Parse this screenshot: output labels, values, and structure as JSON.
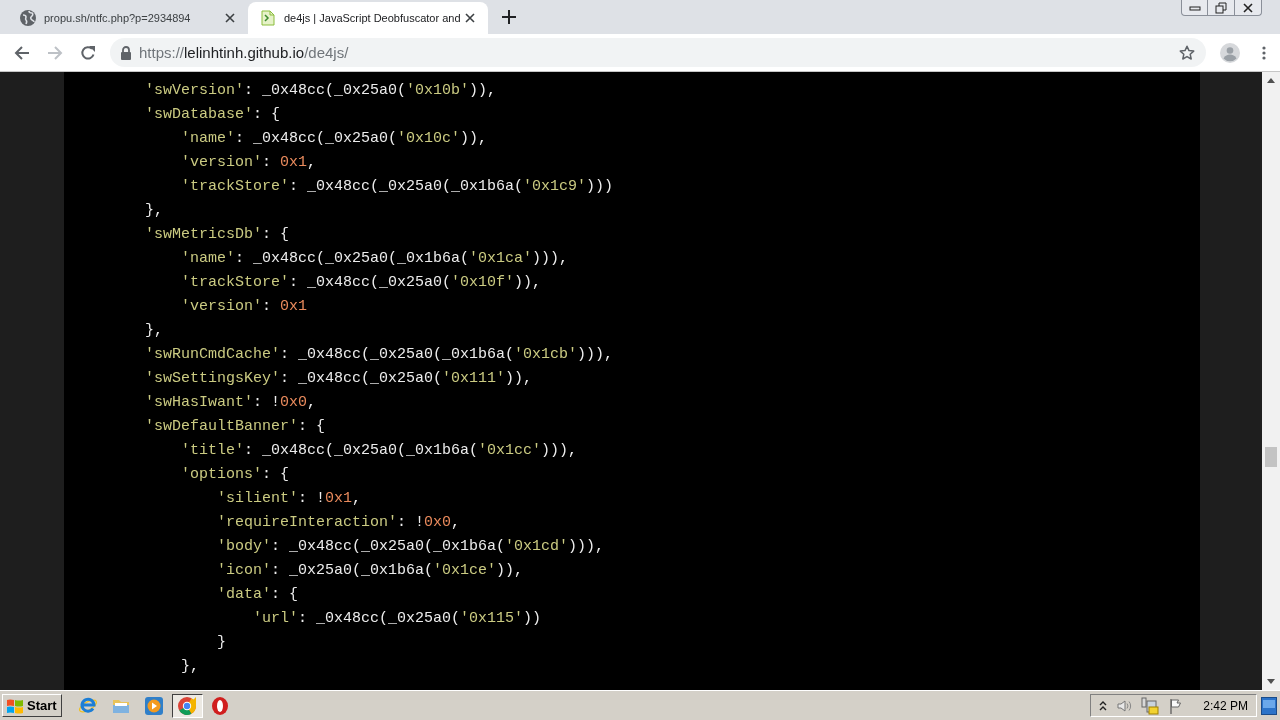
{
  "browser": {
    "tabs": [
      {
        "title": "propu.sh/ntfc.php?p=2934894",
        "kind": "globe",
        "selected": false
      },
      {
        "title": "de4js | JavaScript Deobfuscator and",
        "kind": "page",
        "selected": true
      }
    ],
    "nav_buttons": [
      {
        "kind": "back",
        "disabled": false
      },
      {
        "kind": "forward",
        "disabled": true
      },
      {
        "kind": "reload",
        "disabled": false
      }
    ],
    "address_bar": {
      "scheme": "https://",
      "host": "lelinhtinh.github.io",
      "path": "/de4js/"
    }
  },
  "code": {
    "lines": [
      {
        "tokens": [
          {
            "kind": "string",
            "text": "'swVersion'"
          },
          {
            "kind": "plain",
            "text": ": _0x48cc(_0x25a0("
          },
          {
            "kind": "string",
            "text": "'0x10b'"
          },
          {
            "kind": "plain",
            "text": ")),"
          }
        ]
      },
      {
        "tokens": [
          {
            "kind": "string",
            "text": "'swDatabase'"
          },
          {
            "kind": "plain",
            "text": ": {"
          }
        ],
        "children": [
          {
            "tokens": [
              {
                "kind": "string",
                "text": "'name'"
              },
              {
                "kind": "plain",
                "text": ": _0x48cc(_0x25a0("
              },
              {
                "kind": "string",
                "text": "'0x10c'"
              },
              {
                "kind": "plain",
                "text": ")),"
              }
            ]
          },
          {
            "tokens": [
              {
                "kind": "string",
                "text": "'version'"
              },
              {
                "kind": "plain",
                "text": ": "
              },
              {
                "kind": "number",
                "text": "0x1"
              },
              {
                "kind": "plain",
                "text": ","
              }
            ]
          },
          {
            "tokens": [
              {
                "kind": "string",
                "text": "'trackStore'"
              },
              {
                "kind": "plain",
                "text": ": _0x48cc(_0x25a0(_0x1b6a("
              },
              {
                "kind": "string",
                "text": "'0x1c9'"
              },
              {
                "kind": "plain",
                "text": ")))"
              }
            ]
          }
        ]
      },
      {
        "tokens": [
          {
            "kind": "plain",
            "text": "},"
          }
        ]
      },
      {
        "tokens": [
          {
            "kind": "string",
            "text": "'swMetricsDb'"
          },
          {
            "kind": "plain",
            "text": ": {"
          }
        ],
        "children": [
          {
            "tokens": [
              {
                "kind": "string",
                "text": "'name'"
              },
              {
                "kind": "plain",
                "text": ": _0x48cc(_0x25a0(_0x1b6a("
              },
              {
                "kind": "string",
                "text": "'0x1ca'"
              },
              {
                "kind": "plain",
                "text": "))),"
              }
            ]
          },
          {
            "tokens": [
              {
                "kind": "string",
                "text": "'trackStore'"
              },
              {
                "kind": "plain",
                "text": ": _0x48cc(_0x25a0("
              },
              {
                "kind": "string",
                "text": "'0x10f'"
              },
              {
                "kind": "plain",
                "text": ")),"
              }
            ]
          },
          {
            "tokens": [
              {
                "kind": "string",
                "text": "'version'"
              },
              {
                "kind": "plain",
                "text": ": "
              },
              {
                "kind": "number",
                "text": "0x1"
              }
            ]
          }
        ]
      },
      {
        "tokens": [
          {
            "kind": "plain",
            "text": "},"
          }
        ]
      },
      {
        "tokens": [
          {
            "kind": "string",
            "text": "'swRunCmdCache'"
          },
          {
            "kind": "plain",
            "text": ": _0x48cc(_0x25a0(_0x1b6a("
          },
          {
            "kind": "string",
            "text": "'0x1cb'"
          },
          {
            "kind": "plain",
            "text": "))),"
          }
        ]
      },
      {
        "tokens": [
          {
            "kind": "string",
            "text": "'swSettingsKey'"
          },
          {
            "kind": "plain",
            "text": ": _0x48cc(_0x25a0("
          },
          {
            "kind": "string",
            "text": "'0x111'"
          },
          {
            "kind": "plain",
            "text": ")),"
          }
        ]
      },
      {
        "tokens": [
          {
            "kind": "string",
            "text": "'swHasIwant'"
          },
          {
            "kind": "plain",
            "text": ": !"
          },
          {
            "kind": "number",
            "text": "0x0"
          },
          {
            "kind": "plain",
            "text": ","
          }
        ]
      },
      {
        "tokens": [
          {
            "kind": "string",
            "text": "'swDefaultBanner'"
          },
          {
            "kind": "plain",
            "text": ": {"
          }
        ],
        "children": [
          {
            "tokens": [
              {
                "kind": "string",
                "text": "'title'"
              },
              {
                "kind": "plain",
                "text": ": _0x48cc(_0x25a0(_0x1b6a("
              },
              {
                "kind": "string",
                "text": "'0x1cc'"
              },
              {
                "kind": "plain",
                "text": "))),"
              }
            ]
          },
          {
            "tokens": [
              {
                "kind": "string",
                "text": "'options'"
              },
              {
                "kind": "plain",
                "text": ": {"
              }
            ],
            "children": [
              {
                "tokens": [
                  {
                    "kind": "string",
                    "text": "'silient'"
                  },
                  {
                    "kind": "plain",
                    "text": ": !"
                  },
                  {
                    "kind": "number",
                    "text": "0x1"
                  },
                  {
                    "kind": "plain",
                    "text": ","
                  }
                ]
              },
              {
                "tokens": [
                  {
                    "kind": "string",
                    "text": "'requireInteraction'"
                  },
                  {
                    "kind": "plain",
                    "text": ": !"
                  },
                  {
                    "kind": "number",
                    "text": "0x0"
                  },
                  {
                    "kind": "plain",
                    "text": ","
                  }
                ]
              },
              {
                "tokens": [
                  {
                    "kind": "string",
                    "text": "'body'"
                  },
                  {
                    "kind": "plain",
                    "text": ": _0x48cc(_0x25a0(_0x1b6a("
                  },
                  {
                    "kind": "string",
                    "text": "'0x1cd'"
                  },
                  {
                    "kind": "plain",
                    "text": "))),"
                  }
                ]
              },
              {
                "tokens": [
                  {
                    "kind": "string",
                    "text": "'icon'"
                  },
                  {
                    "kind": "plain",
                    "text": ": _0x25a0(_0x1b6a("
                  },
                  {
                    "kind": "string",
                    "text": "'0x1ce'"
                  },
                  {
                    "kind": "plain",
                    "text": ")),"
                  }
                ]
              },
              {
                "tokens": [
                  {
                    "kind": "string",
                    "text": "'data'"
                  },
                  {
                    "kind": "plain",
                    "text": ": {"
                  }
                ],
                "children": [
                  {
                    "tokens": [
                      {
                        "kind": "string",
                        "text": "'url'"
                      },
                      {
                        "kind": "plain",
                        "text": ": _0x48cc(_0x25a0("
                      },
                      {
                        "kind": "string",
                        "text": "'0x115'"
                      },
                      {
                        "kind": "plain",
                        "text": "))"
                      }
                    ]
                  }
                ]
              },
              {
                "tokens": [
                  {
                    "kind": "plain",
                    "text": "}"
                  }
                ]
              }
            ]
          },
          {
            "tokens": [
              {
                "kind": "plain",
                "text": "},"
              }
            ]
          }
        ]
      }
    ]
  },
  "taskbar": {
    "start_button": "Start",
    "apps": [
      {
        "kind": "eglobe",
        "selected": false
      },
      {
        "kind": "folder",
        "selected": false
      },
      {
        "kind": "player",
        "selected": false
      },
      {
        "kind": "wheel",
        "selected": true
      },
      {
        "kind": "oring",
        "selected": false
      }
    ],
    "clock": "2:42 PM"
  }
}
